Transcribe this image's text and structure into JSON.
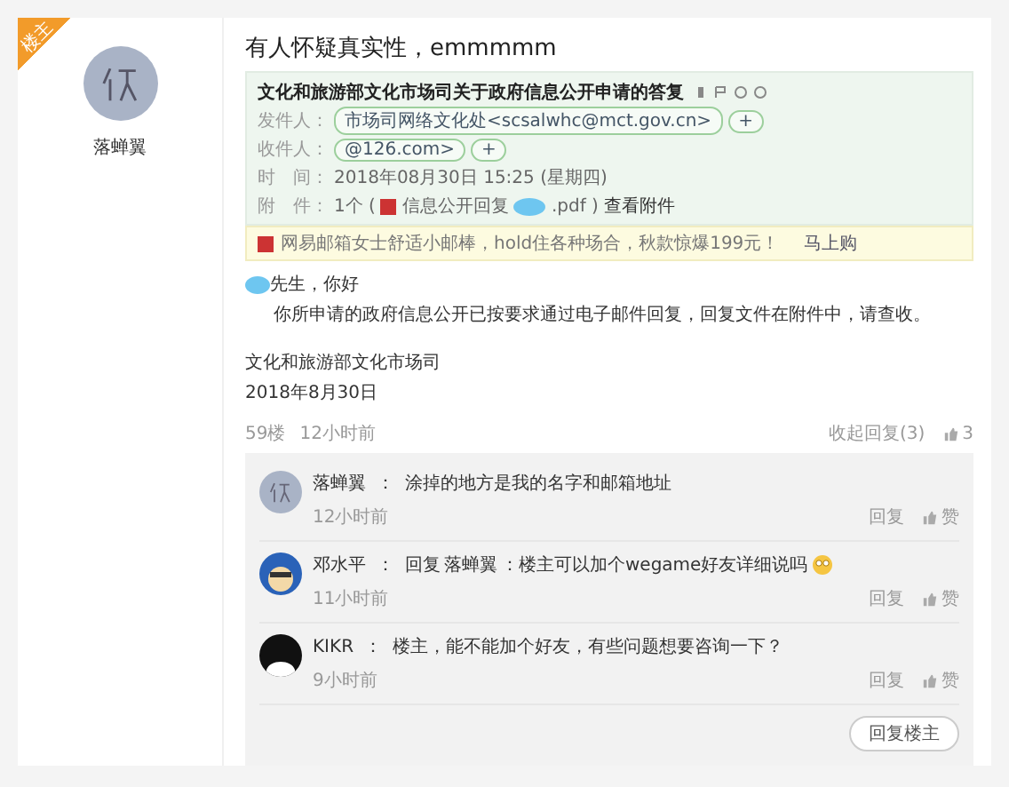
{
  "post": {
    "badge": "楼主",
    "author": "落蝉翼",
    "title": "有人怀疑真实性，emmmmm",
    "email": {
      "subject": "文化和旅游部文化市场司关于政府信息公开申请的答复",
      "fields": [
        {
          "kind": "chip",
          "label": "发件人：",
          "value": "市场司网络文化处<scsalwhc@mct.gov.cn>",
          "extra": "+"
        },
        {
          "kind": "chip",
          "label": "收件人：",
          "value": "@126.com>",
          "extra": "+"
        },
        {
          "kind": "text",
          "label": "时　间：",
          "value": "2018年08月30日 15:25 (星期四)"
        },
        {
          "kind": "attachment",
          "label": "附　件：",
          "value": "1个 (",
          "file": "信息公开回复",
          "ext": ".pdf )",
          "link": "查看附件"
        }
      ],
      "ad": "网易邮箱女士舒适小邮棒，hold住各种场合，秋款惊爆199元！",
      "ad_link": "马上购"
    },
    "body": [
      {
        "kind": "greeting",
        "text": "先生，你好"
      },
      {
        "kind": "indent",
        "text": "你所申请的政府信息公开已按要求通过电子邮件回复，回复文件在附件中，请查收。"
      },
      {
        "kind": "gap",
        "text": "文化和旅游部文化市场司"
      },
      {
        "kind": "plain",
        "text": "2018年8月30日"
      }
    ],
    "floor": "59楼",
    "time": "12小时前",
    "collapse": "收起回复(3)",
    "likes": "3"
  },
  "comments": [
    {
      "avatar": {
        "kind": "glyph"
      },
      "author": "落蝉翼",
      "separator": "：",
      "text": "涂掉的地方是我的名字和邮箱地址",
      "emoji": false,
      "time": "12小时前",
      "reply": "回复",
      "like": "赞"
    },
    {
      "avatar": {
        "kind": "cartoon"
      },
      "author": "邓水平",
      "separator": "：",
      "reply_prefix": "回复",
      "reply_to": "落蝉翼",
      "text": "：楼主可以加个wegame好友详细说吗",
      "emoji": true,
      "time": "11小时前",
      "reply": "回复",
      "like": "赞"
    },
    {
      "avatar": {
        "kind": "dark"
      },
      "author": "KIKR",
      "separator": "：",
      "text": "楼主，能不能加个好友，有些问题想要咨询一下？",
      "emoji": false,
      "time": "9小时前",
      "reply": "回复",
      "like": "赞"
    }
  ],
  "reply_button": "回复楼主"
}
